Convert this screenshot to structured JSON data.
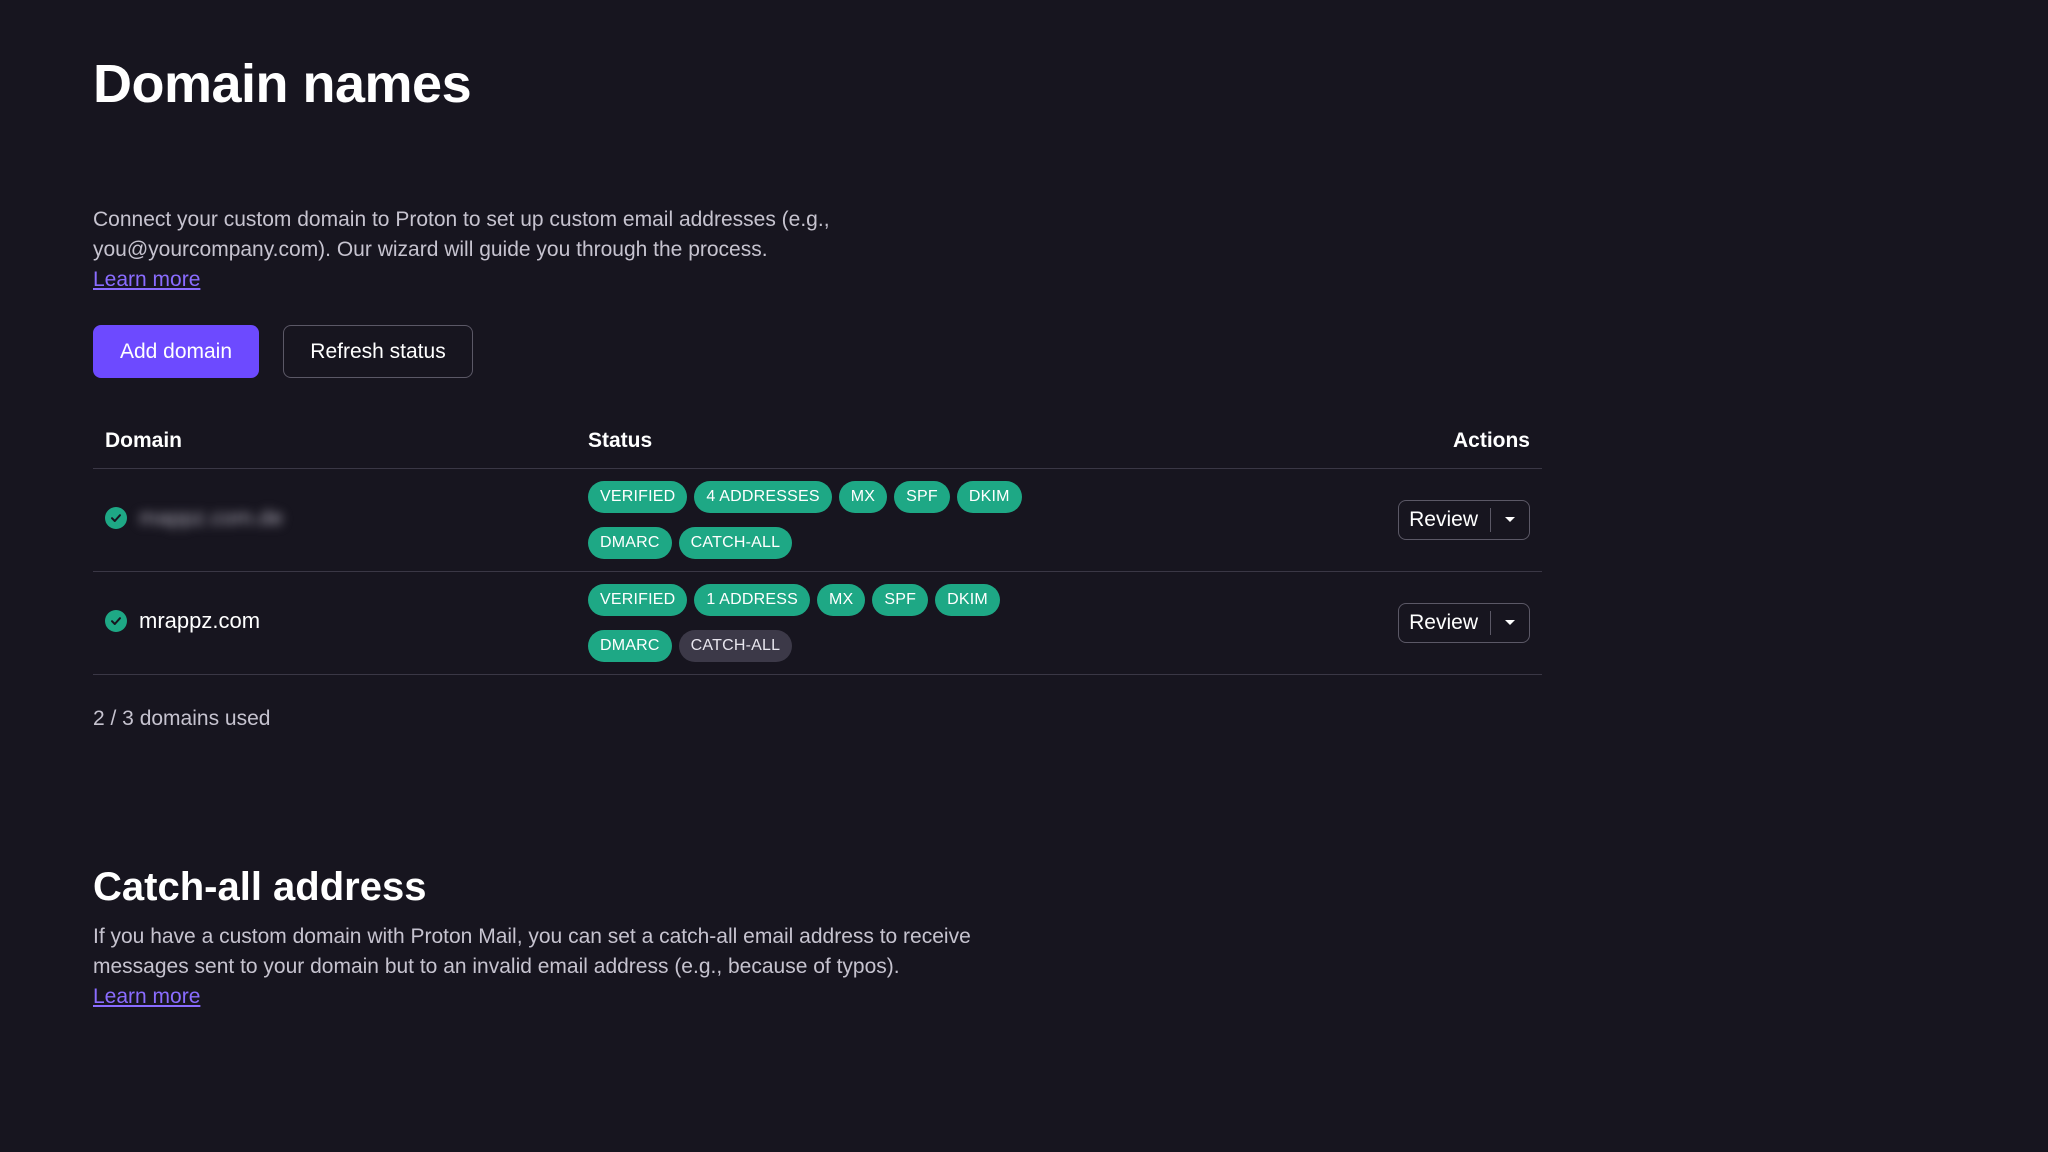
{
  "domains_section": {
    "title": "Domain names",
    "description": "Connect your custom domain to Proton to set up custom email addresses (e.g., you@yourcompany.com). Our wizard will guide you through the process.",
    "learn_more": "Learn more",
    "add_button": "Add domain",
    "refresh_button": "Refresh status"
  },
  "table": {
    "headers": {
      "domain": "Domain",
      "status": "Status",
      "actions": "Actions"
    },
    "rows": [
      {
        "domain": "mappz.com.de",
        "status_icon": "check-circle-icon",
        "badges_line1": [
          "VERIFIED",
          "4 ADDRESSES",
          "MX",
          "SPF",
          "DKIM"
        ],
        "badges_line2": [
          "DMARC",
          "CATCH-ALL"
        ],
        "catchall_active": true,
        "action": "Review"
      },
      {
        "domain": "mrappz.com",
        "status_icon": "check-circle-icon",
        "badges_line1": [
          "VERIFIED",
          "1 ADDRESS",
          "MX",
          "SPF",
          "DKIM"
        ],
        "badges_line2": [
          "DMARC",
          "CATCH-ALL"
        ],
        "catchall_active": false,
        "action": "Review"
      }
    ]
  },
  "usage": "2 / 3 domains used",
  "catchall_section": {
    "title": "Catch-all address",
    "description": "If you have a custom domain with Proton Mail, you can set a catch-all email address to receive messages sent to your domain but to an invalid email address (e.g., because of typos).",
    "learn_more": "Learn more"
  },
  "colors": {
    "background": "#17151f",
    "accent": "#6d4aff",
    "link": "#8a6cff",
    "success": "#1ea885"
  }
}
